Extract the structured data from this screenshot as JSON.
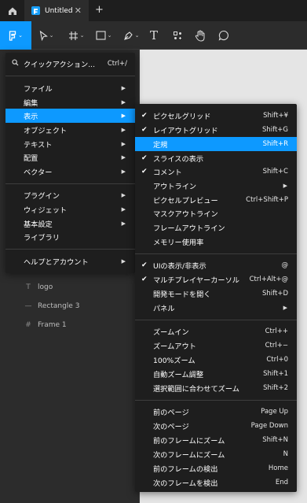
{
  "tabs": {
    "home_icon": "home-icon",
    "title": "Untitled",
    "close": "✕",
    "new_tab": "+"
  },
  "toolbar": {
    "tools": [
      "main-menu",
      "move",
      "frame",
      "shape",
      "pen",
      "text",
      "resources",
      "hand",
      "comment"
    ],
    "text_tool_glyph": "T"
  },
  "layers": [
    {
      "icon": "T",
      "name": "logo"
    },
    {
      "icon": "—",
      "name": "Rectangle 3"
    },
    {
      "icon": "#",
      "name": "Frame 1"
    }
  ],
  "main_menu": {
    "quick_actions": {
      "label": "クイックアクション...",
      "shortcut": "Ctrl+/"
    },
    "items": [
      {
        "label": "ファイル"
      },
      {
        "label": "編集"
      },
      {
        "label": "表示"
      },
      {
        "label": "オブジェクト"
      },
      {
        "label": "テキスト"
      },
      {
        "label": "配置"
      },
      {
        "label": "ベクター"
      },
      {
        "label": "プラグイン"
      },
      {
        "label": "ウィジェット"
      },
      {
        "label": "基本設定"
      },
      {
        "label": "ライブラリ"
      },
      {
        "label": "ヘルプとアカウント"
      }
    ]
  },
  "view_menu": {
    "items": [
      {
        "label": "ピクセルグリッド",
        "shortcut": "Shift+¥",
        "checked": true
      },
      {
        "label": "レイアウトグリッド",
        "shortcut": "Shift+G",
        "checked": true
      },
      {
        "label": "定規",
        "shortcut": "Shift+R",
        "checked": false
      },
      {
        "label": "スライスの表示",
        "shortcut": "",
        "checked": true
      },
      {
        "label": "コメント",
        "shortcut": "Shift+C",
        "checked": true
      },
      {
        "label": "アウトライン",
        "shortcut": "",
        "checked": false
      },
      {
        "label": "ピクセルプレビュー",
        "shortcut": "Ctrl+Shift+P",
        "checked": false
      },
      {
        "label": "マスクアウトライン",
        "shortcut": "",
        "checked": false
      },
      {
        "label": "フレームアウトライン",
        "shortcut": "",
        "checked": false
      },
      {
        "label": "メモリー使用率",
        "shortcut": "",
        "checked": false
      },
      {
        "label": "UIの表示/非表示",
        "shortcut": "@",
        "checked": true
      },
      {
        "label": "マルチプレイヤーカーソル",
        "shortcut": "Ctrl+Alt+@",
        "checked": true
      },
      {
        "label": "開発モードを開く",
        "shortcut": "Shift+D",
        "checked": false
      },
      {
        "label": "パネル",
        "shortcut": "",
        "checked": false
      },
      {
        "label": "ズームイン",
        "shortcut": "Ctrl++",
        "checked": false
      },
      {
        "label": "ズームアウト",
        "shortcut": "Ctrl+−",
        "checked": false
      },
      {
        "label": "100%ズーム",
        "shortcut": "Ctrl+0",
        "checked": false
      },
      {
        "label": "自動ズーム調整",
        "shortcut": "Shift+1",
        "checked": false
      },
      {
        "label": "選択範囲に合わせてズーム",
        "shortcut": "Shift+2",
        "checked": false
      },
      {
        "label": "前のページ",
        "shortcut": "Page Up",
        "checked": false
      },
      {
        "label": "次のページ",
        "shortcut": "Page Down",
        "checked": false
      },
      {
        "label": "前のフレームにズーム",
        "shortcut": "Shift+N",
        "checked": false
      },
      {
        "label": "次のフレームにズーム",
        "shortcut": "N",
        "checked": false
      },
      {
        "label": "前のフレームの検出",
        "shortcut": "Home",
        "checked": false
      },
      {
        "label": "次のフレームを検出",
        "shortcut": "End",
        "checked": false
      }
    ]
  }
}
